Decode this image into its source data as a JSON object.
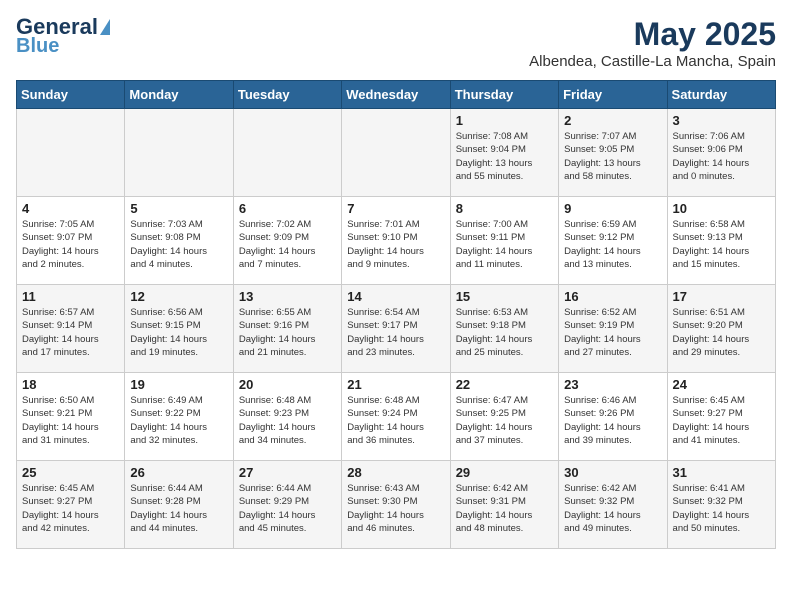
{
  "header": {
    "logo_line1": "General",
    "logo_line2": "Blue",
    "month": "May 2025",
    "location": "Albendea, Castille-La Mancha, Spain"
  },
  "columns": [
    "Sunday",
    "Monday",
    "Tuesday",
    "Wednesday",
    "Thursday",
    "Friday",
    "Saturday"
  ],
  "weeks": [
    [
      {
        "day": "",
        "info": ""
      },
      {
        "day": "",
        "info": ""
      },
      {
        "day": "",
        "info": ""
      },
      {
        "day": "",
        "info": ""
      },
      {
        "day": "1",
        "info": "Sunrise: 7:08 AM\nSunset: 9:04 PM\nDaylight: 13 hours\nand 55 minutes."
      },
      {
        "day": "2",
        "info": "Sunrise: 7:07 AM\nSunset: 9:05 PM\nDaylight: 13 hours\nand 58 minutes."
      },
      {
        "day": "3",
        "info": "Sunrise: 7:06 AM\nSunset: 9:06 PM\nDaylight: 14 hours\nand 0 minutes."
      }
    ],
    [
      {
        "day": "4",
        "info": "Sunrise: 7:05 AM\nSunset: 9:07 PM\nDaylight: 14 hours\nand 2 minutes."
      },
      {
        "day": "5",
        "info": "Sunrise: 7:03 AM\nSunset: 9:08 PM\nDaylight: 14 hours\nand 4 minutes."
      },
      {
        "day": "6",
        "info": "Sunrise: 7:02 AM\nSunset: 9:09 PM\nDaylight: 14 hours\nand 7 minutes."
      },
      {
        "day": "7",
        "info": "Sunrise: 7:01 AM\nSunset: 9:10 PM\nDaylight: 14 hours\nand 9 minutes."
      },
      {
        "day": "8",
        "info": "Sunrise: 7:00 AM\nSunset: 9:11 PM\nDaylight: 14 hours\nand 11 minutes."
      },
      {
        "day": "9",
        "info": "Sunrise: 6:59 AM\nSunset: 9:12 PM\nDaylight: 14 hours\nand 13 minutes."
      },
      {
        "day": "10",
        "info": "Sunrise: 6:58 AM\nSunset: 9:13 PM\nDaylight: 14 hours\nand 15 minutes."
      }
    ],
    [
      {
        "day": "11",
        "info": "Sunrise: 6:57 AM\nSunset: 9:14 PM\nDaylight: 14 hours\nand 17 minutes."
      },
      {
        "day": "12",
        "info": "Sunrise: 6:56 AM\nSunset: 9:15 PM\nDaylight: 14 hours\nand 19 minutes."
      },
      {
        "day": "13",
        "info": "Sunrise: 6:55 AM\nSunset: 9:16 PM\nDaylight: 14 hours\nand 21 minutes."
      },
      {
        "day": "14",
        "info": "Sunrise: 6:54 AM\nSunset: 9:17 PM\nDaylight: 14 hours\nand 23 minutes."
      },
      {
        "day": "15",
        "info": "Sunrise: 6:53 AM\nSunset: 9:18 PM\nDaylight: 14 hours\nand 25 minutes."
      },
      {
        "day": "16",
        "info": "Sunrise: 6:52 AM\nSunset: 9:19 PM\nDaylight: 14 hours\nand 27 minutes."
      },
      {
        "day": "17",
        "info": "Sunrise: 6:51 AM\nSunset: 9:20 PM\nDaylight: 14 hours\nand 29 minutes."
      }
    ],
    [
      {
        "day": "18",
        "info": "Sunrise: 6:50 AM\nSunset: 9:21 PM\nDaylight: 14 hours\nand 31 minutes."
      },
      {
        "day": "19",
        "info": "Sunrise: 6:49 AM\nSunset: 9:22 PM\nDaylight: 14 hours\nand 32 minutes."
      },
      {
        "day": "20",
        "info": "Sunrise: 6:48 AM\nSunset: 9:23 PM\nDaylight: 14 hours\nand 34 minutes."
      },
      {
        "day": "21",
        "info": "Sunrise: 6:48 AM\nSunset: 9:24 PM\nDaylight: 14 hours\nand 36 minutes."
      },
      {
        "day": "22",
        "info": "Sunrise: 6:47 AM\nSunset: 9:25 PM\nDaylight: 14 hours\nand 37 minutes."
      },
      {
        "day": "23",
        "info": "Sunrise: 6:46 AM\nSunset: 9:26 PM\nDaylight: 14 hours\nand 39 minutes."
      },
      {
        "day": "24",
        "info": "Sunrise: 6:45 AM\nSunset: 9:27 PM\nDaylight: 14 hours\nand 41 minutes."
      }
    ],
    [
      {
        "day": "25",
        "info": "Sunrise: 6:45 AM\nSunset: 9:27 PM\nDaylight: 14 hours\nand 42 minutes."
      },
      {
        "day": "26",
        "info": "Sunrise: 6:44 AM\nSunset: 9:28 PM\nDaylight: 14 hours\nand 44 minutes."
      },
      {
        "day": "27",
        "info": "Sunrise: 6:44 AM\nSunset: 9:29 PM\nDaylight: 14 hours\nand 45 minutes."
      },
      {
        "day": "28",
        "info": "Sunrise: 6:43 AM\nSunset: 9:30 PM\nDaylight: 14 hours\nand 46 minutes."
      },
      {
        "day": "29",
        "info": "Sunrise: 6:42 AM\nSunset: 9:31 PM\nDaylight: 14 hours\nand 48 minutes."
      },
      {
        "day": "30",
        "info": "Sunrise: 6:42 AM\nSunset: 9:32 PM\nDaylight: 14 hours\nand 49 minutes."
      },
      {
        "day": "31",
        "info": "Sunrise: 6:41 AM\nSunset: 9:32 PM\nDaylight: 14 hours\nand 50 minutes."
      }
    ]
  ]
}
